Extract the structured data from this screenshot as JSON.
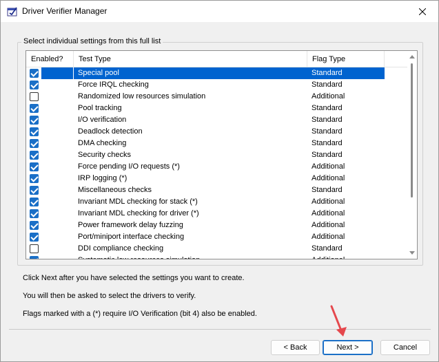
{
  "window": {
    "title": "Driver Verifier Manager",
    "close_glyph": "✕"
  },
  "group": {
    "legend": "Select individual settings from this full list"
  },
  "list": {
    "columns": [
      "Enabled?",
      "Test Type",
      "Flag Type"
    ],
    "rows": [
      {
        "enabled": true,
        "name": "Special pool",
        "flag": "Standard",
        "selected": true
      },
      {
        "enabled": true,
        "name": "Force IRQL checking",
        "flag": "Standard"
      },
      {
        "enabled": false,
        "name": "Randomized low resources simulation",
        "flag": "Additional"
      },
      {
        "enabled": true,
        "name": "Pool tracking",
        "flag": "Standard"
      },
      {
        "enabled": true,
        "name": "I/O verification",
        "flag": "Standard"
      },
      {
        "enabled": true,
        "name": "Deadlock detection",
        "flag": "Standard"
      },
      {
        "enabled": true,
        "name": "DMA checking",
        "flag": "Standard"
      },
      {
        "enabled": true,
        "name": "Security checks",
        "flag": "Standard"
      },
      {
        "enabled": true,
        "name": "Force pending I/O requests (*)",
        "flag": "Additional"
      },
      {
        "enabled": true,
        "name": "IRP logging (*)",
        "flag": "Additional"
      },
      {
        "enabled": true,
        "name": "Miscellaneous checks",
        "flag": "Standard"
      },
      {
        "enabled": true,
        "name": "Invariant MDL checking for stack (*)",
        "flag": "Additional"
      },
      {
        "enabled": true,
        "name": "Invariant MDL checking for driver (*)",
        "flag": "Additional"
      },
      {
        "enabled": true,
        "name": "Power framework delay fuzzing",
        "flag": "Additional"
      },
      {
        "enabled": true,
        "name": "Port/miniport interface checking",
        "flag": "Additional"
      },
      {
        "enabled": false,
        "name": "DDI compliance checking",
        "flag": "Standard"
      },
      {
        "enabled": true,
        "name": "Systematic low resources simulation",
        "flag": "Additional"
      }
    ]
  },
  "info": {
    "line1": "Click Next after you have selected the settings you want to create.",
    "line2": "You will then be asked to select the drivers to verify.",
    "line3": "Flags marked with a (*) require I/O Verification (bit 4) also be enabled."
  },
  "buttons": {
    "back": "< Back",
    "next": "Next >",
    "cancel": "Cancel"
  },
  "colors": {
    "selection": "#0063cf",
    "checkbox": "#1a6fc7",
    "annotation_arrow": "#e5484d"
  },
  "icons": {
    "app": "driver-verifier-icon",
    "close": "close-icon"
  }
}
